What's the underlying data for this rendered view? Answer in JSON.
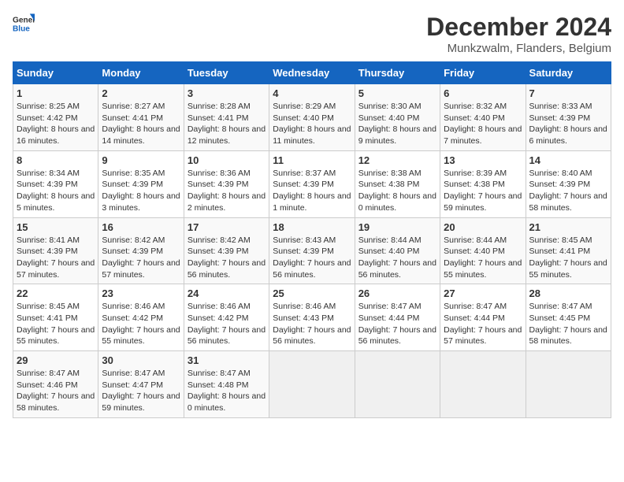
{
  "header": {
    "logo_general": "General",
    "logo_blue": "Blue",
    "title": "December 2024",
    "subtitle": "Munkzwalm, Flanders, Belgium"
  },
  "weekdays": [
    "Sunday",
    "Monday",
    "Tuesday",
    "Wednesday",
    "Thursday",
    "Friday",
    "Saturday"
  ],
  "weeks": [
    [
      {
        "day": "1",
        "sunrise": "Sunrise: 8:25 AM",
        "sunset": "Sunset: 4:42 PM",
        "daylight": "Daylight: 8 hours and 16 minutes."
      },
      {
        "day": "2",
        "sunrise": "Sunrise: 8:27 AM",
        "sunset": "Sunset: 4:41 PM",
        "daylight": "Daylight: 8 hours and 14 minutes."
      },
      {
        "day": "3",
        "sunrise": "Sunrise: 8:28 AM",
        "sunset": "Sunset: 4:41 PM",
        "daylight": "Daylight: 8 hours and 12 minutes."
      },
      {
        "day": "4",
        "sunrise": "Sunrise: 8:29 AM",
        "sunset": "Sunset: 4:40 PM",
        "daylight": "Daylight: 8 hours and 11 minutes."
      },
      {
        "day": "5",
        "sunrise": "Sunrise: 8:30 AM",
        "sunset": "Sunset: 4:40 PM",
        "daylight": "Daylight: 8 hours and 9 minutes."
      },
      {
        "day": "6",
        "sunrise": "Sunrise: 8:32 AM",
        "sunset": "Sunset: 4:40 PM",
        "daylight": "Daylight: 8 hours and 7 minutes."
      },
      {
        "day": "7",
        "sunrise": "Sunrise: 8:33 AM",
        "sunset": "Sunset: 4:39 PM",
        "daylight": "Daylight: 8 hours and 6 minutes."
      }
    ],
    [
      {
        "day": "8",
        "sunrise": "Sunrise: 8:34 AM",
        "sunset": "Sunset: 4:39 PM",
        "daylight": "Daylight: 8 hours and 5 minutes."
      },
      {
        "day": "9",
        "sunrise": "Sunrise: 8:35 AM",
        "sunset": "Sunset: 4:39 PM",
        "daylight": "Daylight: 8 hours and 3 minutes."
      },
      {
        "day": "10",
        "sunrise": "Sunrise: 8:36 AM",
        "sunset": "Sunset: 4:39 PM",
        "daylight": "Daylight: 8 hours and 2 minutes."
      },
      {
        "day": "11",
        "sunrise": "Sunrise: 8:37 AM",
        "sunset": "Sunset: 4:39 PM",
        "daylight": "Daylight: 8 hours and 1 minute."
      },
      {
        "day": "12",
        "sunrise": "Sunrise: 8:38 AM",
        "sunset": "Sunset: 4:38 PM",
        "daylight": "Daylight: 8 hours and 0 minutes."
      },
      {
        "day": "13",
        "sunrise": "Sunrise: 8:39 AM",
        "sunset": "Sunset: 4:38 PM",
        "daylight": "Daylight: 7 hours and 59 minutes."
      },
      {
        "day": "14",
        "sunrise": "Sunrise: 8:40 AM",
        "sunset": "Sunset: 4:39 PM",
        "daylight": "Daylight: 7 hours and 58 minutes."
      }
    ],
    [
      {
        "day": "15",
        "sunrise": "Sunrise: 8:41 AM",
        "sunset": "Sunset: 4:39 PM",
        "daylight": "Daylight: 7 hours and 57 minutes."
      },
      {
        "day": "16",
        "sunrise": "Sunrise: 8:42 AM",
        "sunset": "Sunset: 4:39 PM",
        "daylight": "Daylight: 7 hours and 57 minutes."
      },
      {
        "day": "17",
        "sunrise": "Sunrise: 8:42 AM",
        "sunset": "Sunset: 4:39 PM",
        "daylight": "Daylight: 7 hours and 56 minutes."
      },
      {
        "day": "18",
        "sunrise": "Sunrise: 8:43 AM",
        "sunset": "Sunset: 4:39 PM",
        "daylight": "Daylight: 7 hours and 56 minutes."
      },
      {
        "day": "19",
        "sunrise": "Sunrise: 8:44 AM",
        "sunset": "Sunset: 4:40 PM",
        "daylight": "Daylight: 7 hours and 56 minutes."
      },
      {
        "day": "20",
        "sunrise": "Sunrise: 8:44 AM",
        "sunset": "Sunset: 4:40 PM",
        "daylight": "Daylight: 7 hours and 55 minutes."
      },
      {
        "day": "21",
        "sunrise": "Sunrise: 8:45 AM",
        "sunset": "Sunset: 4:41 PM",
        "daylight": "Daylight: 7 hours and 55 minutes."
      }
    ],
    [
      {
        "day": "22",
        "sunrise": "Sunrise: 8:45 AM",
        "sunset": "Sunset: 4:41 PM",
        "daylight": "Daylight: 7 hours and 55 minutes."
      },
      {
        "day": "23",
        "sunrise": "Sunrise: 8:46 AM",
        "sunset": "Sunset: 4:42 PM",
        "daylight": "Daylight: 7 hours and 55 minutes."
      },
      {
        "day": "24",
        "sunrise": "Sunrise: 8:46 AM",
        "sunset": "Sunset: 4:42 PM",
        "daylight": "Daylight: 7 hours and 56 minutes."
      },
      {
        "day": "25",
        "sunrise": "Sunrise: 8:46 AM",
        "sunset": "Sunset: 4:43 PM",
        "daylight": "Daylight: 7 hours and 56 minutes."
      },
      {
        "day": "26",
        "sunrise": "Sunrise: 8:47 AM",
        "sunset": "Sunset: 4:44 PM",
        "daylight": "Daylight: 7 hours and 56 minutes."
      },
      {
        "day": "27",
        "sunrise": "Sunrise: 8:47 AM",
        "sunset": "Sunset: 4:44 PM",
        "daylight": "Daylight: 7 hours and 57 minutes."
      },
      {
        "day": "28",
        "sunrise": "Sunrise: 8:47 AM",
        "sunset": "Sunset: 4:45 PM",
        "daylight": "Daylight: 7 hours and 58 minutes."
      }
    ],
    [
      {
        "day": "29",
        "sunrise": "Sunrise: 8:47 AM",
        "sunset": "Sunset: 4:46 PM",
        "daylight": "Daylight: 7 hours and 58 minutes."
      },
      {
        "day": "30",
        "sunrise": "Sunrise: 8:47 AM",
        "sunset": "Sunset: 4:47 PM",
        "daylight": "Daylight: 7 hours and 59 minutes."
      },
      {
        "day": "31",
        "sunrise": "Sunrise: 8:47 AM",
        "sunset": "Sunset: 4:48 PM",
        "daylight": "Daylight: 8 hours and 0 minutes."
      },
      null,
      null,
      null,
      null
    ]
  ]
}
